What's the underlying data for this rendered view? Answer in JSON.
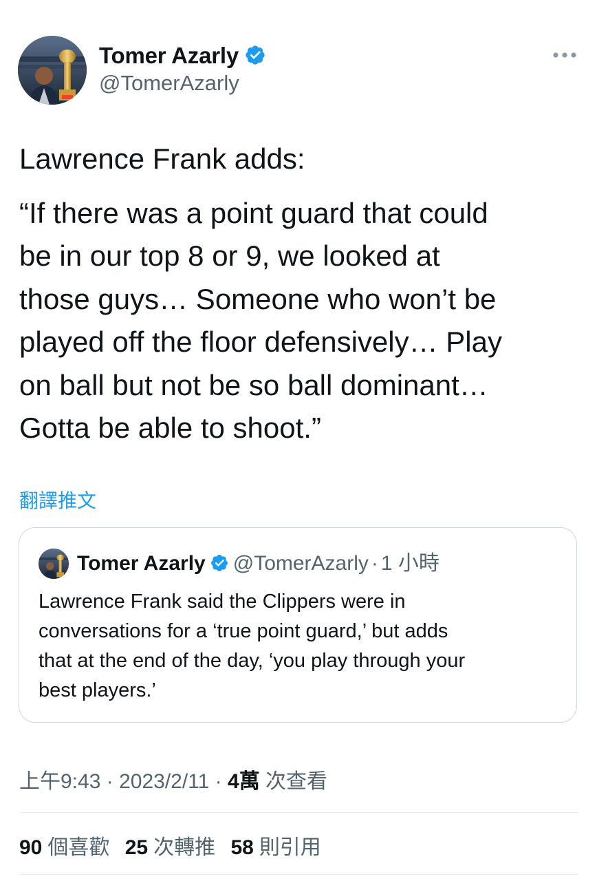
{
  "tweet": {
    "author": {
      "name": "Tomer Azarly",
      "handle": "@TomerAzarly",
      "verified": true
    },
    "text_lines": [
      "Lawrence Frank adds:",
      "“If there was a point guard that could",
      "be in our top 8 or 9, we looked at",
      "those guys… Someone who won’t be",
      "played off the floor defensively… Play",
      "on ball but not be so ball dominant…",
      "Gotta be able to shoot.”"
    ],
    "translate_label": "翻譯推文",
    "quoted_tweet": {
      "name": "Tomer Azarly",
      "handle": "@TomerAzarly",
      "separator": "·",
      "time": "1 小時",
      "text_lines": [
        "Lawrence Frank said the Clippers were in",
        "conversations for a ‘true point guard,’ but adds",
        "that at the end of the day, ‘you play through your",
        "best players.’"
      ]
    },
    "meta": {
      "time": "上午9:43",
      "separator": "·",
      "date": "2023/2/11",
      "views_count": "4萬",
      "views_label": "次查看"
    },
    "stats": {
      "likes_count": "90",
      "likes_label": "個喜歡",
      "retweets_count": "25",
      "retweets_label": "次轉推",
      "quotes_count": "58",
      "quotes_label": "則引用"
    }
  },
  "colors": {
    "accent": "#1d9bf0",
    "text_primary": "#0f1419",
    "text_secondary": "#536471",
    "border": "#cfd9de"
  },
  "icons": {
    "verified": "verified-badge-icon",
    "more": "more-options-icon"
  }
}
